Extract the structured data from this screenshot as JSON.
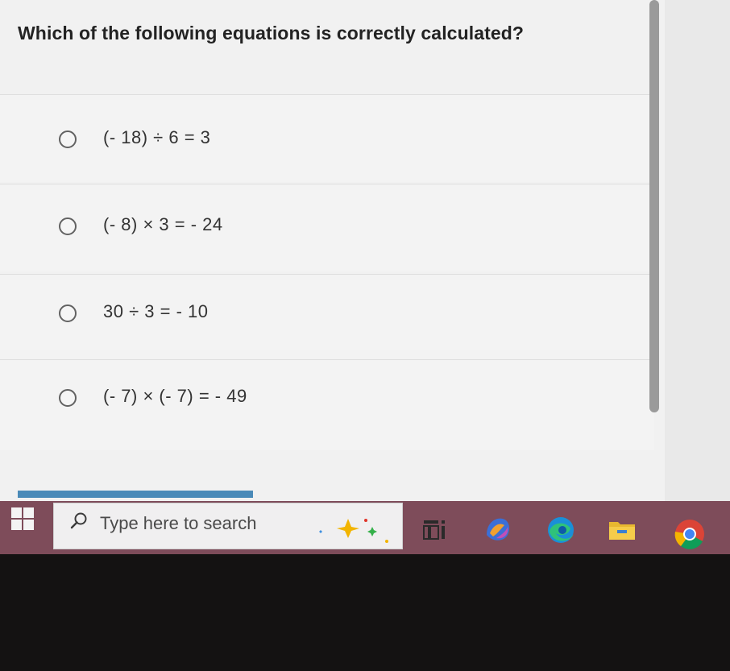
{
  "question": {
    "text": "Which of the following equations is correctly calculated?"
  },
  "options": [
    {
      "label": "(- 18) ÷ 6 = 3",
      "selected": false
    },
    {
      "label": "(- 8) × 3 = - 24",
      "selected": false
    },
    {
      "label": "30 ÷ 3 = - 10",
      "selected": false
    },
    {
      "label": "(- 7) × (- 7) = - 49",
      "selected": false
    }
  ],
  "taskbar": {
    "search_placeholder": "Type here to search",
    "pinned": [
      "task-view-icon",
      "copilot-app-icon",
      "edge-icon",
      "file-explorer-icon",
      "chrome-icon"
    ]
  },
  "colors": {
    "taskbar": "#7e4c5a",
    "progress": "#4a8ab8",
    "question_text": "#232323"
  }
}
